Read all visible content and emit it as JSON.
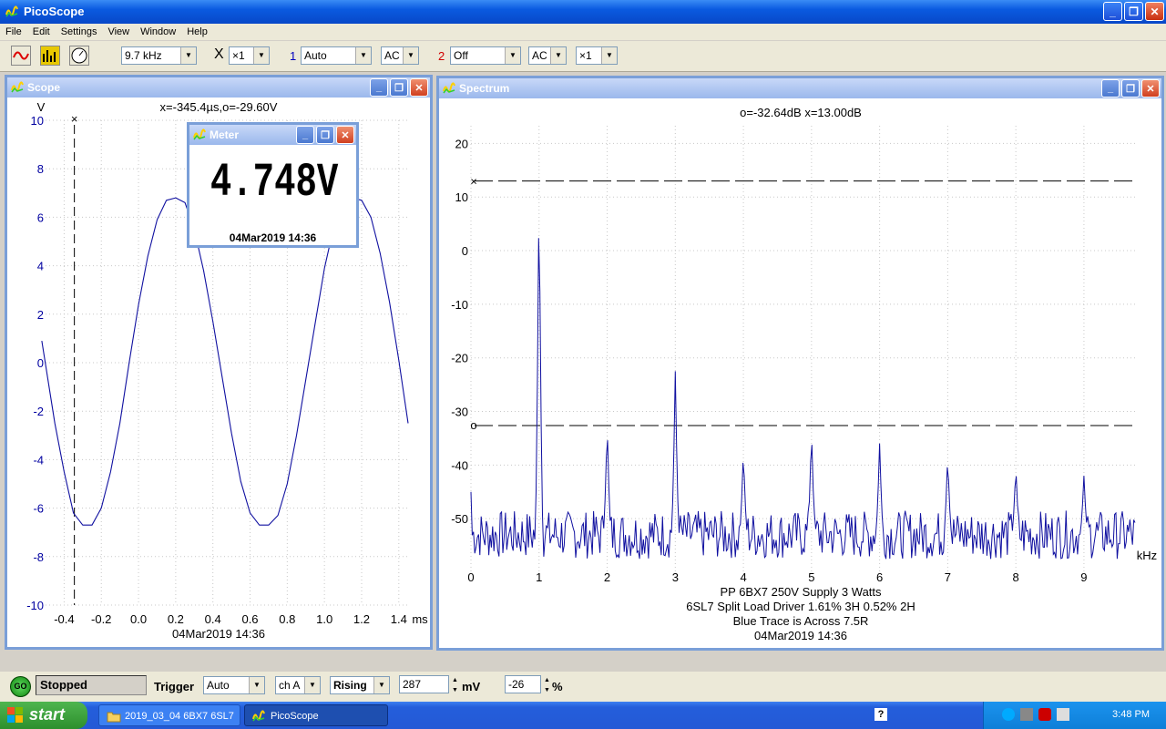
{
  "app": {
    "title": "PicoScope"
  },
  "menu": [
    "File",
    "Edit",
    "Settings",
    "View",
    "Window",
    "Help"
  ],
  "toolbar": {
    "timebase": "9.7 kHz",
    "x_mult_icon": "X",
    "x_mult": "×1",
    "ch1_num": "1",
    "ch1_range": "Auto",
    "ch1_coupling": "AC",
    "ch2_num": "2",
    "ch2_range": "Off",
    "ch2_coupling": "AC",
    "ch2_mult": "×1",
    "icons": [
      "scope-icon",
      "spectrum-icon",
      "meter-icon"
    ]
  },
  "scope": {
    "title": "Scope",
    "readout": "x=-345.4µs,o=-29.60V",
    "y_unit": "V",
    "x_unit": "ms",
    "timestamp": "04Mar2019  14:36",
    "cursor_mark": "×",
    "chart_data": {
      "type": "line",
      "xlabel": "ms",
      "ylabel": "V",
      "xlim": [
        -0.5,
        1.45
      ],
      "ylim": [
        -10,
        10
      ],
      "x_ticks": [
        "-0.4",
        "-0.2",
        "0.0",
        "0.2",
        "0.4",
        "0.6",
        "0.8",
        "1.0",
        "1.2",
        "1.4"
      ],
      "y_ticks": [
        "10",
        "8",
        "6",
        "4",
        "2",
        "0",
        "-2",
        "-4",
        "-6",
        "-8",
        "-10"
      ],
      "cursor_x": -0.345,
      "series": [
        {
          "x": [
            -0.52,
            -0.45,
            -0.4,
            -0.35,
            -0.3,
            -0.25,
            -0.2,
            -0.15,
            -0.1,
            -0.05,
            0,
            0.05,
            0.1,
            0.15,
            0.2,
            0.25,
            0.3,
            0.35,
            0.4,
            0.45,
            0.5,
            0.55,
            0.6,
            0.65,
            0.7,
            0.75,
            0.8,
            0.85,
            0.9,
            0.95,
            1,
            1.05,
            1.1,
            1.15,
            1.2,
            1.25,
            1.3,
            1.35,
            1.4,
            1.45
          ],
          "y": [
            0.9,
            -2.5,
            -4.5,
            -6.2,
            -6.7,
            -6.7,
            -6,
            -4.5,
            -2.5,
            0,
            2.4,
            4.4,
            5.9,
            6.7,
            6.8,
            6.6,
            5.5,
            3.8,
            1.7,
            -0.6,
            -2.9,
            -4.9,
            -6.2,
            -6.7,
            -6.7,
            -6.3,
            -5,
            -3,
            -0.7,
            1.6,
            3.9,
            5.6,
            6.6,
            6.8,
            6.7,
            6,
            4.5,
            2.5,
            0.1,
            -2.5
          ]
        }
      ]
    }
  },
  "meter": {
    "title": "Meter",
    "value": "4.748V",
    "timestamp": "04Mar2019  14:36"
  },
  "spectrum": {
    "title": "Spectrum",
    "readout": "o=-32.64dB  x=13.00dB",
    "x_unit": "kHz",
    "cursor_mark_x": "×",
    "cursor_mark_o": "o",
    "annotation": [
      "PP 6BX7 250V Supply 3 Watts",
      "6SL7 Split Load Driver 1.61% 3H 0.52% 2H",
      "Blue Trace is Across 7.5R",
      "04Mar2019  14:36"
    ],
    "chart_data": {
      "type": "line",
      "xlabel": "kHz",
      "xlim": [
        0,
        9.75
      ],
      "ylim": [
        -60,
        25
      ],
      "x_ticks": [
        "0",
        "1",
        "2",
        "3",
        "4",
        "5",
        "6",
        "7",
        "8",
        "9"
      ],
      "y_ticks": [
        "20",
        "10",
        "0",
        "-10",
        "-20",
        "-30",
        "-40",
        "-50"
      ],
      "cursor_x_db": 13.0,
      "cursor_o_db": -32.64,
      "peaks": [
        {
          "f": 1,
          "db": 13
        },
        {
          "f": 2,
          "db": -32
        },
        {
          "f": 3,
          "db": -22.5
        },
        {
          "f": 4,
          "db": -37
        },
        {
          "f": 5,
          "db": -33
        },
        {
          "f": 6,
          "db": -36
        },
        {
          "f": 7,
          "db": -38
        },
        {
          "f": 8,
          "db": -40
        },
        {
          "f": 9,
          "db": -42
        }
      ],
      "noise_floor_db": -53
    }
  },
  "status": {
    "run_state": "Stopped",
    "trigger_label": "Trigger",
    "trigger_mode": "Auto",
    "trigger_channel": "ch A",
    "trigger_edge": "Rising",
    "trigger_level": "287",
    "level_unit": "mV",
    "pretrigger": "-26",
    "pre_unit": "%",
    "go_label": "GO"
  },
  "taskbar": {
    "start": "start",
    "tasks": [
      "2019_03_04 6BX7 6SL7",
      "PicoScope"
    ],
    "clock": "3:48 PM"
  }
}
